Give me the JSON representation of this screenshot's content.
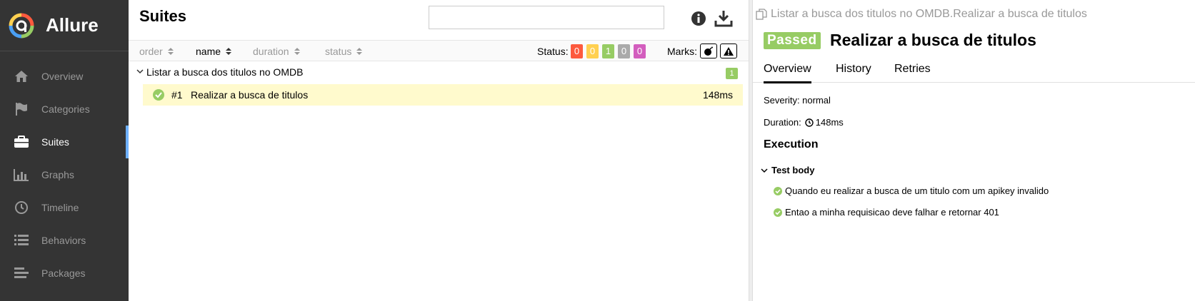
{
  "sidebar": {
    "brand": "Allure",
    "items": [
      {
        "label": "Overview",
        "icon": "home-icon"
      },
      {
        "label": "Categories",
        "icon": "flag-icon"
      },
      {
        "label": "Suites",
        "icon": "briefcase-icon",
        "active": true
      },
      {
        "label": "Graphs",
        "icon": "bar-chart-icon"
      },
      {
        "label": "Timeline",
        "icon": "clock-icon"
      },
      {
        "label": "Behaviors",
        "icon": "list-icon"
      },
      {
        "label": "Packages",
        "icon": "align-left-icon"
      }
    ]
  },
  "suites": {
    "title": "Suites",
    "search": {
      "value": "",
      "placeholder": ""
    },
    "sort": [
      "order",
      "name",
      "duration",
      "status"
    ],
    "active_sort": "name",
    "status_label": "Status:",
    "status_counts": [
      {
        "name": "failed",
        "count": "0",
        "color": "#fd5a3e"
      },
      {
        "name": "broken",
        "count": "0",
        "color": "#ffd050"
      },
      {
        "name": "passed",
        "count": "1",
        "color": "#97cc64"
      },
      {
        "name": "skipped",
        "count": "0",
        "color": "#aaaaaa"
      },
      {
        "name": "unknown",
        "count": "0",
        "color": "#d35ebe"
      }
    ],
    "marks_label": "Marks:",
    "group": {
      "label": "Listar a busca dos titulos no OMDB",
      "count": "1"
    },
    "rows": [
      {
        "number": "#1",
        "name": "Realizar a busca de titulos",
        "duration": "148ms",
        "status": "passed"
      }
    ]
  },
  "detail": {
    "breadcrumb": "Listar a busca dos titulos no OMDB.Realizar a busca de titulos",
    "status_badge": "Passed",
    "title": "Realizar a busca de titulos",
    "tabs": [
      "Overview",
      "History",
      "Retries"
    ],
    "severity": "Severity: normal",
    "duration_label": "Duration:",
    "duration_value": "148ms",
    "execution_heading": "Execution",
    "test_body_label": "Test body",
    "steps": [
      "Quando eu realizar a busca de um titulo com um apikey invalido",
      "Entao a minha requisicao deve falhar e retornar 401"
    ]
  },
  "colors": {
    "sidebar_bg": "#343434",
    "active_indicator": "#6eb1ff",
    "passed": "#97cc64",
    "row_highlight": "#fffacd"
  }
}
